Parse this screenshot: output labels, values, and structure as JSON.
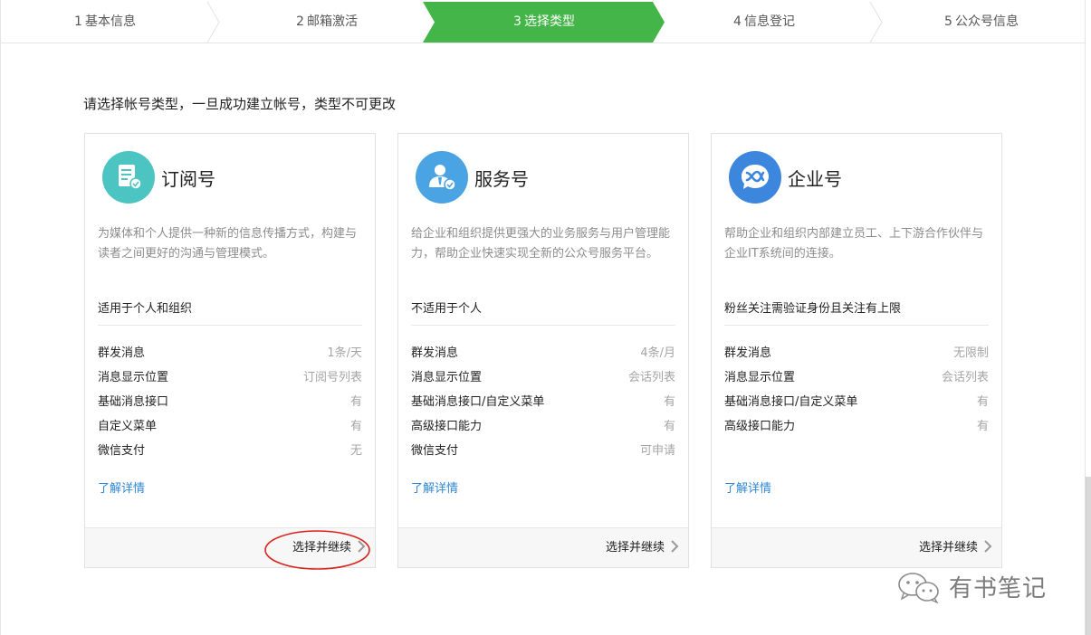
{
  "stepper": {
    "steps": [
      {
        "num": "1",
        "label": "基本信息"
      },
      {
        "num": "2",
        "label": "邮箱激活"
      },
      {
        "num": "3",
        "label": "选择类型"
      },
      {
        "num": "4",
        "label": "信息登记"
      },
      {
        "num": "5",
        "label": "公众号信息"
      }
    ],
    "active_index": 2,
    "active_color": "#44b549"
  },
  "intro": "请选择帐号类型，一旦成功建立帐号，类型不可更改",
  "cards": [
    {
      "title": "订阅号",
      "icon": "subscription-icon",
      "icon_color": "#4cc5c2",
      "desc": "为媒体和个人提供一种新的信息传播方式，构建与读者之间更好的沟通与管理模式。",
      "suit": "适用于个人和组织",
      "features": [
        {
          "k": "群发消息",
          "v": "1条/天"
        },
        {
          "k": "消息显示位置",
          "v": "订阅号列表"
        },
        {
          "k": "基础消息接口",
          "v": "有"
        },
        {
          "k": "自定义菜单",
          "v": "有"
        },
        {
          "k": "微信支付",
          "v": "无"
        }
      ],
      "more": "了解详情",
      "choose": "选择并继续"
    },
    {
      "title": "服务号",
      "icon": "service-icon",
      "icon_color": "#4aa3e2",
      "desc": "给企业和组织提供更强大的业务服务与用户管理能力，帮助企业快速实现全新的公众号服务平台。",
      "suit": "不适用于个人",
      "features": [
        {
          "k": "群发消息",
          "v": "4条/月"
        },
        {
          "k": "消息显示位置",
          "v": "会话列表"
        },
        {
          "k": "基础消息接口/自定义菜单",
          "v": "有"
        },
        {
          "k": "高级接口能力",
          "v": "有"
        },
        {
          "k": "微信支付",
          "v": "可申请"
        }
      ],
      "more": "了解详情",
      "choose": "选择并继续"
    },
    {
      "title": "企业号",
      "icon": "enterprise-icon",
      "icon_color": "#3d86de",
      "desc": "帮助企业和组织内部建立员工、上下游合作伙伴与企业IT系统间的连接。",
      "suit": "粉丝关注需验证身份且关注有上限",
      "features": [
        {
          "k": "群发消息",
          "v": "无限制"
        },
        {
          "k": "消息显示位置",
          "v": "会话列表"
        },
        {
          "k": "基础消息接口/自定义菜单",
          "v": "有"
        },
        {
          "k": "高级接口能力",
          "v": "有"
        }
      ],
      "more": "了解详情",
      "choose": "选择并继续"
    }
  ],
  "watermark": "有书笔记"
}
